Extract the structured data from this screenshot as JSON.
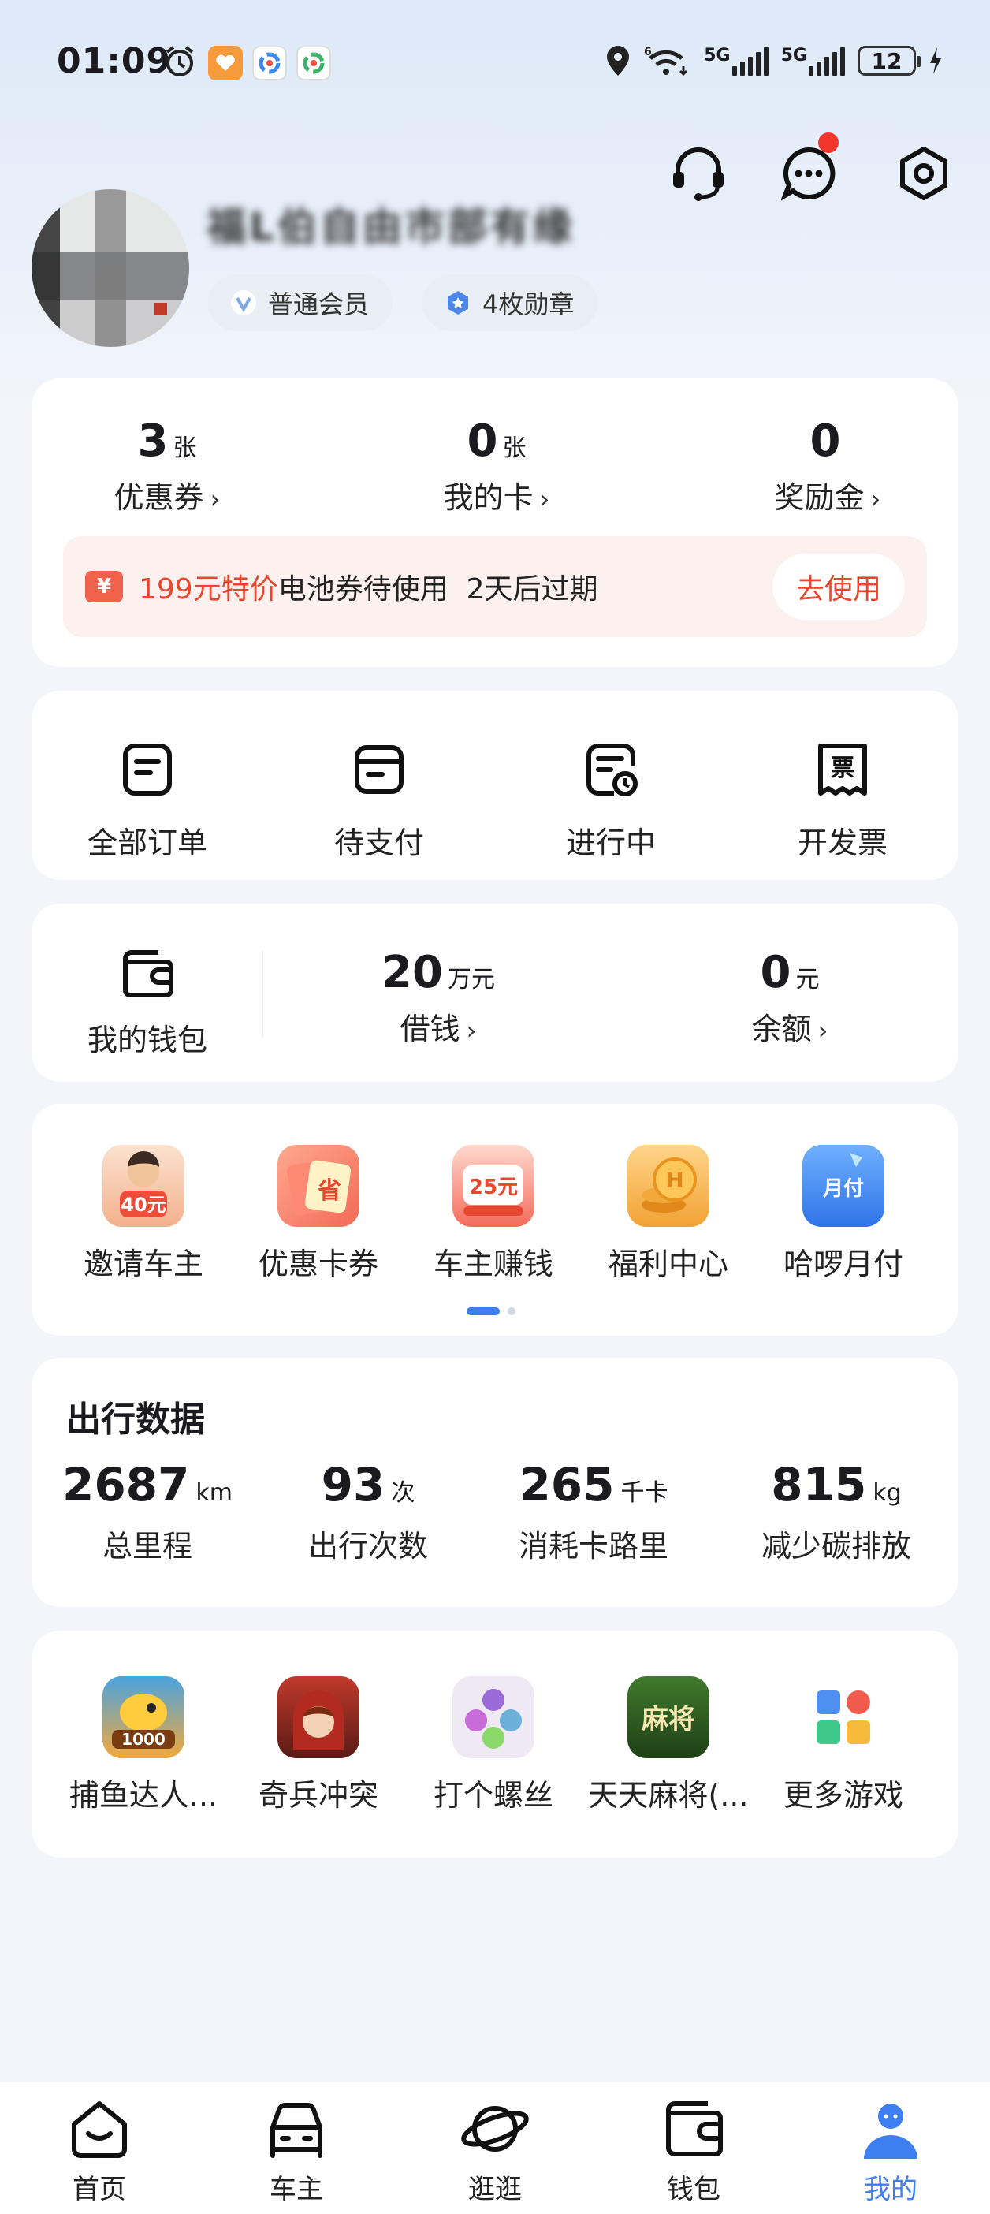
{
  "status_bar": {
    "time": "01:09",
    "network_1": "5G",
    "network_2": "5G",
    "battery": "12"
  },
  "header": {
    "username": "福L伯自由市部有缘",
    "badges": [
      {
        "label": "普通会员",
        "icon": "member-v-icon"
      },
      {
        "label": "4枚勋章",
        "icon": "medal-hex-icon"
      }
    ]
  },
  "assets": {
    "items": [
      {
        "num": "3",
        "unit": "张",
        "label": "优惠券"
      },
      {
        "num": "0",
        "unit": "张",
        "label": "我的卡"
      },
      {
        "num": "0",
        "unit": "",
        "label": "奖励金"
      }
    ],
    "promo": {
      "icon_text": "¥",
      "highlight": "199元特价",
      "text": "电池券待使用  2天后过期",
      "button": "去使用"
    }
  },
  "orders": [
    {
      "label": "全部订单",
      "icon": "order-list-icon"
    },
    {
      "label": "待支付",
      "icon": "pending-pay-icon"
    },
    {
      "label": "进行中",
      "icon": "in-progress-icon"
    },
    {
      "label": "开发票",
      "icon": "invoice-icon"
    }
  ],
  "wallet": {
    "label": "我的钱包",
    "loan": {
      "num": "20",
      "unit": "万元",
      "label": "借钱"
    },
    "balance": {
      "num": "0",
      "unit": "元",
      "label": "余额"
    }
  },
  "services": [
    {
      "label": "邀请车主",
      "img_text": "40元",
      "color": "#f6c9a8"
    },
    {
      "label": "优惠卡券",
      "img_text": "省",
      "color": "#f77d6b"
    },
    {
      "label": "车主赚钱",
      "img_text": "25元",
      "color": "#ef5a4c"
    },
    {
      "label": "福利中心",
      "img_text": "H",
      "color": "#f4a53a"
    },
    {
      "label": "哈啰月付",
      "img_text": "月付",
      "color": "#3f8cf3"
    }
  ],
  "trip": {
    "title": "出行数据",
    "items": [
      {
        "num": "2687",
        "unit": "km",
        "label": "总里程"
      },
      {
        "num": "93",
        "unit": "次",
        "label": "出行次数"
      },
      {
        "num": "265",
        "unit": "千卡",
        "label": "消耗卡路里"
      },
      {
        "num": "815",
        "unit": "kg",
        "label": "减少碳排放"
      }
    ]
  },
  "games": [
    {
      "label": "捕鱼达人...",
      "img_text": "1000",
      "color": "#f2a93b"
    },
    {
      "label": "奇兵冲突",
      "img_text": "",
      "color": "#8e2a24"
    },
    {
      "label": "打个螺丝",
      "img_text": "",
      "color": "#e9e4ef"
    },
    {
      "label": "天天麻将(...",
      "img_text": "麻将",
      "color": "#2f5b22"
    },
    {
      "label": "更多游戏",
      "img_text": "",
      "color": "#ffffff"
    }
  ],
  "tabs": [
    {
      "label": "首页",
      "icon": "home-icon"
    },
    {
      "label": "车主",
      "icon": "car-icon"
    },
    {
      "label": "逛逛",
      "icon": "planet-icon"
    },
    {
      "label": "钱包",
      "icon": "wallet-icon"
    },
    {
      "label": "我的",
      "icon": "profile-icon",
      "active": true
    }
  ]
}
